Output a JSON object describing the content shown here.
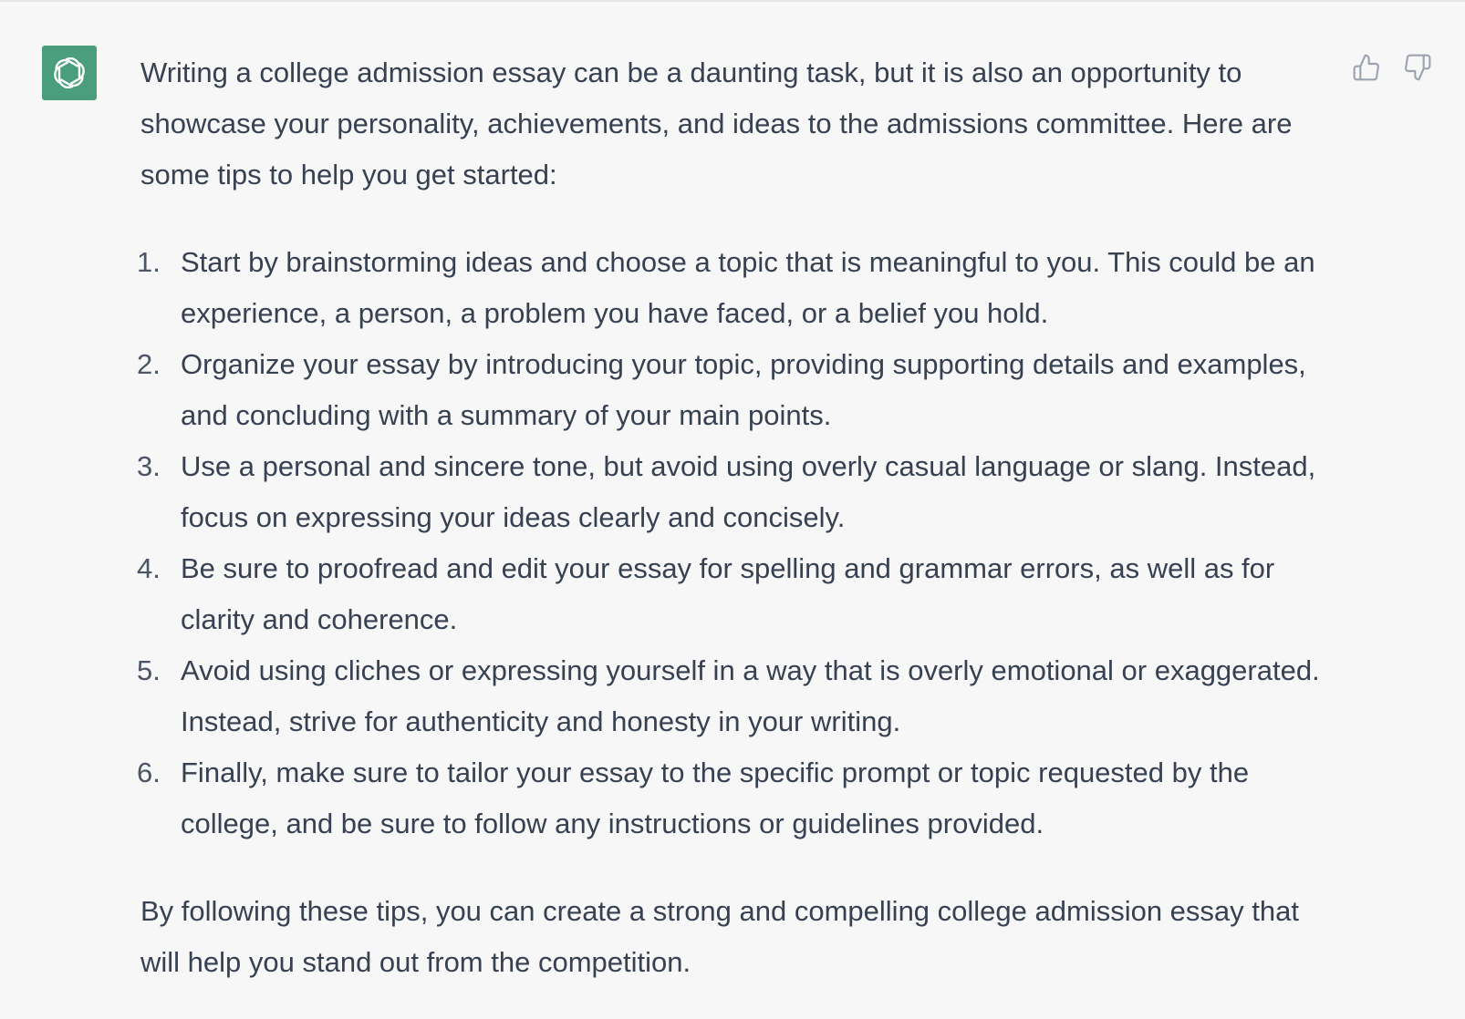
{
  "message": {
    "intro": "Writing a college admission essay can be a daunting task, but it is also an opportunity to showcase your personality, achievements, and ideas to the admissions committee. Here are some tips to help you get started:",
    "tips": [
      {
        "num": "1.",
        "text": "Start by brainstorming ideas and choose a topic that is meaningful to you. This could be an experience, a person, a problem you have faced, or a belief you hold."
      },
      {
        "num": "2.",
        "text": "Organize your essay by introducing your topic, providing supporting details and examples, and concluding with a summary of your main points."
      },
      {
        "num": "3.",
        "text": "Use a personal and sincere tone, but avoid using overly casual language or slang. Instead, focus on expressing your ideas clearly and concisely."
      },
      {
        "num": "4.",
        "text": "Be sure to proofread and edit your essay for spelling and grammar errors, as well as for clarity and coherence."
      },
      {
        "num": "5.",
        "text": "Avoid using cliches or expressing yourself in a way that is overly emotional or exaggerated. Instead, strive for authenticity and honesty in your writing."
      },
      {
        "num": "6.",
        "text": "Finally, make sure to tailor your essay to the specific prompt or topic requested by the college, and be sure to follow any instructions or guidelines provided."
      }
    ],
    "outro": "By following these tips, you can create a strong and compelling college admission essay that will help you stand out from the competition."
  },
  "icons": {
    "avatar": "assistant-logo-icon",
    "like": "thumbs-up-icon",
    "dislike": "thumbs-down-icon"
  },
  "colors": {
    "background": "#f7f7f8",
    "avatar": "#4a9e7e",
    "text": "#374151",
    "icon": "#9ca3af"
  }
}
